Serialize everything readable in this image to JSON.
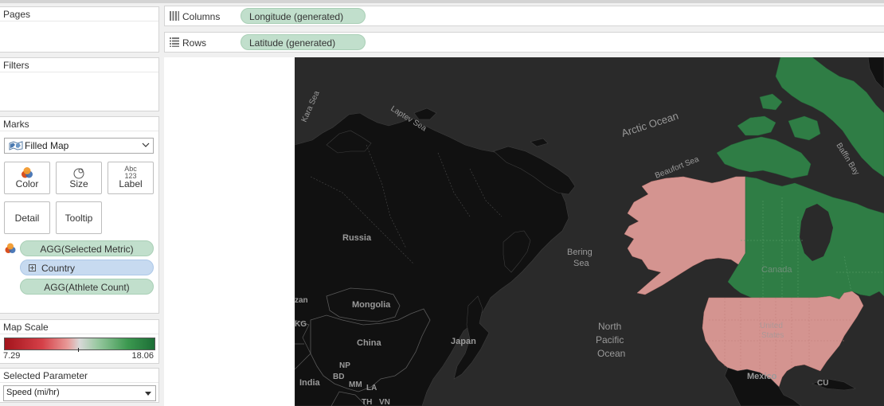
{
  "panels": {
    "pages": {
      "title": "Pages"
    },
    "filters": {
      "title": "Filters"
    },
    "marks": {
      "title": "Marks",
      "mark_type": "Filled Map",
      "buttons": {
        "color": "Color",
        "size": "Size",
        "label": "Label",
        "label_glyph_top": "Abc",
        "label_glyph_bottom": "123",
        "detail": "Detail",
        "tooltip": "Tooltip"
      },
      "fields": [
        {
          "name": "AGG(Selected Metric)",
          "type": "color"
        },
        {
          "name": "Country",
          "type": "detail"
        },
        {
          "name": "AGG(Athlete Count)",
          "type": "size"
        }
      ]
    },
    "map_scale": {
      "title": "Map Scale",
      "min": "7.29",
      "max": "18.06",
      "colors": [
        "#a3141c",
        "#d8d8d8",
        "#1c6e36"
      ]
    },
    "selected_parameter": {
      "title": "Selected Parameter",
      "value": "Speed (mi/hr)"
    }
  },
  "shelves": {
    "columns": {
      "label": "Columns",
      "pill": "Longitude (generated)"
    },
    "rows": {
      "label": "Rows",
      "pill": "Latitude (generated)"
    }
  },
  "map": {
    "colors": {
      "background": "#2a2a2a",
      "land": "#111111",
      "canada": "#2f7d45",
      "usa_alaska": "#d49490"
    },
    "labels": {
      "kara_sea": "Kara Sea",
      "laptev_sea": "Laptev Sea",
      "arctic_ocean": "Arctic Ocean",
      "beaufort_sea": "Beaufort Sea",
      "baffin_bay": "Baffin Bay",
      "russia": "Russia",
      "bering_sea_1": "Bering",
      "bering_sea_2": "Sea",
      "canada": "Canada",
      "mongolia": "Mongolia",
      "china": "China",
      "japan": "Japan",
      "north_pacific_1": "North",
      "north_pacific_2": "Pacific",
      "north_pacific_3": "Ocean",
      "united_states_1": "United",
      "united_states_2": "States",
      "mexico": "Mexico",
      "cu": "CU",
      "kazakhstan": "zan",
      "kg": "KG",
      "india": "India",
      "np": "NP",
      "bd": "BD",
      "mm": "MM",
      "la": "LA",
      "th": "TH",
      "vn": "VN"
    }
  }
}
